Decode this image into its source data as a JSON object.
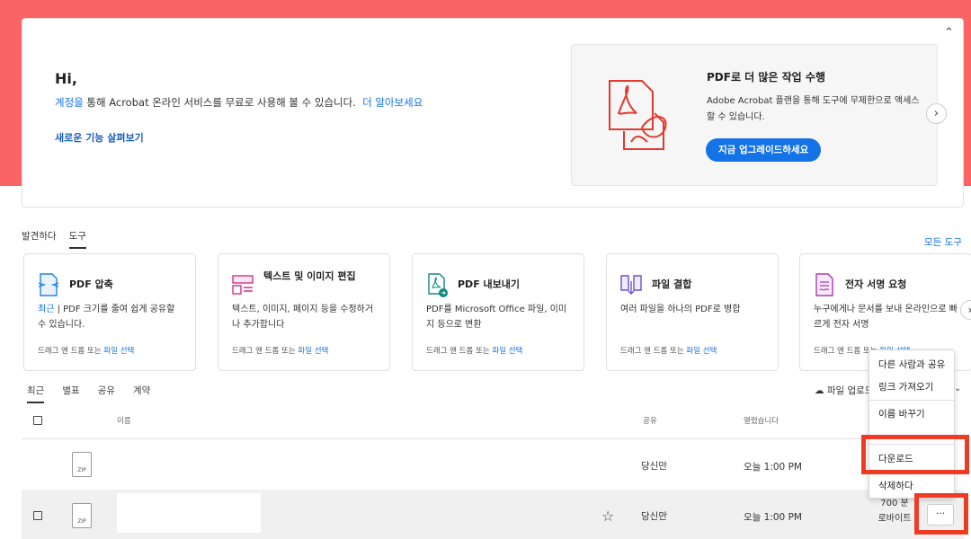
{
  "hero": {
    "greeting": "Hi,",
    "intro_link": "계정을",
    "intro_text": " 통해 Acrobat 온라인 서비스를 무료로 사용해 볼 수 있습니다.",
    "learn_more": "더 알아보세요",
    "whats_new": "새로운 기능 살펴보기"
  },
  "promo": {
    "title": "PDF로 더 많은 작업 수행",
    "desc": "Adobe Acrobat 플랜을 통해 도구에 무제한으로 액세스할 수 있습니다.",
    "button": "지금 업그레이드하세요"
  },
  "top_tabs": [
    "발견하다",
    "도구"
  ],
  "all_tools": "모든 도구",
  "tools": [
    {
      "title": "PDF 압축",
      "desc_prefix": "최근",
      "desc": " | PDF 크기를 줄여 쉽게 공유할 수 있습니다.",
      "drop": "드래그 앤 드롭 또는 ",
      "select": "파일 선택"
    },
    {
      "title": "텍스트 및 이미지 편집",
      "desc": "텍스트, 이미지, 페이지 등을 수정하거나 추가합니다",
      "drop": "드래그 앤 드롭 또는 ",
      "select": "파일 선택"
    },
    {
      "title": "PDF 내보내기",
      "desc": "PDF를 Microsoft Office 파일, 이미지 등으로 변환",
      "drop": "드래그 앤 드롭 또는 ",
      "select": "파일 선택"
    },
    {
      "title": "파일 결합",
      "desc": "여러 파일을 하나의 PDF로 병합",
      "drop": "드래그 앤 드롭 또는 ",
      "select": "파일 선택"
    },
    {
      "title": "전자 서명 요청",
      "desc": "누구에게나 문서를 보내 온라인으로 빠르게 전자 서명",
      "drop": "드래그 앤 드롭 또는 ",
      "select": "파일 선택"
    }
  ],
  "file_tabs": [
    "최근",
    "별표",
    "공유",
    "계약"
  ],
  "upload": "파일 업로드",
  "columns": {
    "name": "이름",
    "share": "공유",
    "opened": "열렸습니다"
  },
  "rows": [
    {
      "icon": "ZIP",
      "share": "당신만",
      "opened": "오늘 1:00 PM"
    },
    {
      "icon": "ZIP",
      "share": "당신만",
      "opened": "오늘 1:00 PM",
      "size": "700 분로바이트"
    }
  ],
  "menu": [
    "다른 사람과 공유",
    "링크 가져오기",
    "이름 바꾸기",
    "다운로드",
    "삭제하다"
  ],
  "more": "···",
  "colors": {
    "hero": "#fa6464",
    "accent": "#1473e6",
    "highlight": "#ee3b24"
  }
}
